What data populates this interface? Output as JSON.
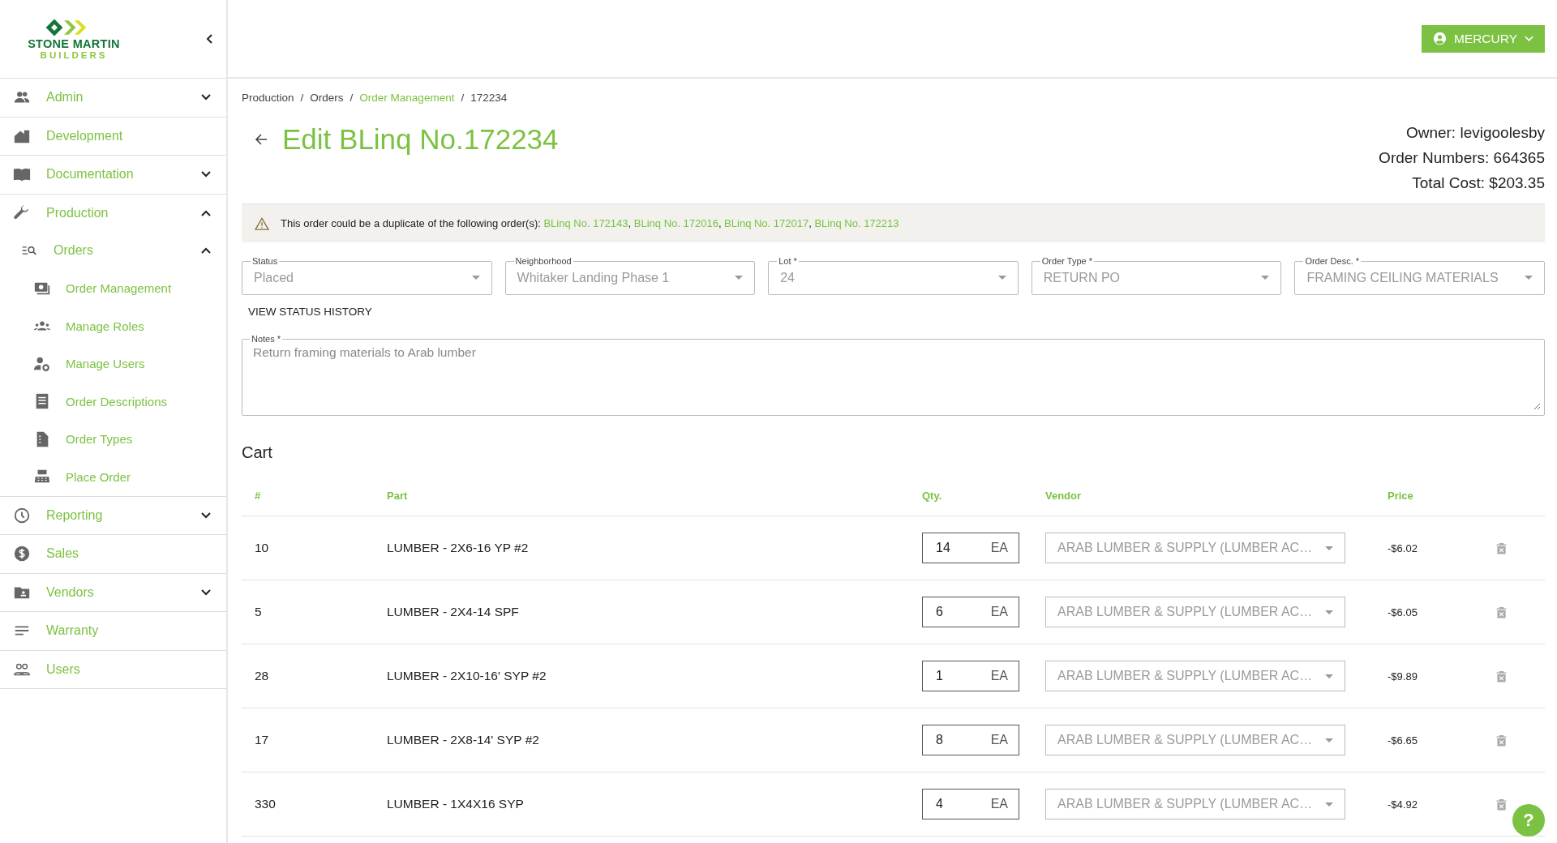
{
  "sidebar": {
    "logo": {
      "name": "STONE MARTIN",
      "tagline": "BUILDERS"
    },
    "items": [
      {
        "label": "Admin",
        "expanded": false
      },
      {
        "label": "Development"
      },
      {
        "label": "Documentation",
        "expanded": false
      },
      {
        "label": "Production",
        "expanded": true,
        "children": [
          {
            "label": "Orders",
            "expanded": true,
            "children": [
              {
                "label": "Order Management"
              },
              {
                "label": "Manage Roles"
              },
              {
                "label": "Manage Users"
              },
              {
                "label": "Order Descriptions"
              },
              {
                "label": "Order Types"
              },
              {
                "label": "Place Order"
              }
            ]
          }
        ]
      },
      {
        "label": "Reporting",
        "expanded": false
      },
      {
        "label": "Sales"
      },
      {
        "label": "Vendors",
        "expanded": false
      },
      {
        "label": "Warranty"
      },
      {
        "label": "Users"
      }
    ]
  },
  "header": {
    "user_button": "MERCURY"
  },
  "breadcrumb": [
    {
      "label": "Production",
      "link": false
    },
    {
      "separator": "/",
      "label": "Orders",
      "link": false
    },
    {
      "separator": "/",
      "label": "Order Management",
      "link": true
    },
    {
      "separator": "/",
      "label": "172234",
      "link": false
    }
  ],
  "page": {
    "title": "Edit BLinq No.172234",
    "owner": "Owner: levigoolesby",
    "order_numbers": "Order Numbers: 664365",
    "total_cost": "Total Cost: $203.35"
  },
  "alert": {
    "message": "This order could be a duplicate of the following order(s):",
    "links": [
      {
        "label": "BLinq No. 172143",
        "separator": ","
      },
      {
        "label": "BLinq No. 172016",
        "separator": ","
      },
      {
        "label": "BLinq No. 172017",
        "separator": ","
      },
      {
        "label": "BLinq No. 172213"
      }
    ]
  },
  "fields": [
    {
      "label": "Status",
      "value": "Placed"
    },
    {
      "label": "Neighborhood",
      "value": "Whitaker Landing Phase 1"
    },
    {
      "label": "Lot *",
      "value": "24"
    },
    {
      "label": "Order Type *",
      "value": "RETURN PO"
    },
    {
      "label": "Order Desc. *",
      "value": "FRAMING CEILING MATERIALS"
    }
  ],
  "status_history_button": "VIEW STATUS HISTORY",
  "notes": {
    "label": "Notes *",
    "value": "Return framing materials to Arab lumber"
  },
  "cart": {
    "title": "Cart",
    "columns": [
      "#",
      "Part",
      "Qty.",
      "Vendor",
      "Price"
    ],
    "rows": [
      {
        "number": "10",
        "part": "LUMBER - 2X6-16 YP #2",
        "qty": "14",
        "unit": "EA",
        "vendor": "ARAB LUMBER & SUPPLY (LUMBER AC…",
        "price": "-$6.02"
      },
      {
        "number": "5",
        "part": "LUMBER - 2X4-14 SPF",
        "qty": "6",
        "unit": "EA",
        "vendor": "ARAB LUMBER & SUPPLY (LUMBER AC…",
        "price": "-$6.05"
      },
      {
        "number": "28",
        "part": "LUMBER - 2X10-16' SYP #2",
        "qty": "1",
        "unit": "EA",
        "vendor": "ARAB LUMBER & SUPPLY (LUMBER AC…",
        "price": "-$9.89"
      },
      {
        "number": "17",
        "part": "LUMBER - 2X8-14' SYP #2",
        "qty": "8",
        "unit": "EA",
        "vendor": "ARAB LUMBER & SUPPLY (LUMBER AC…",
        "price": "-$6.65"
      },
      {
        "number": "330",
        "part": "LUMBER - 1X4X16 SYP",
        "qty": "4",
        "unit": "EA",
        "vendor": "ARAB LUMBER & SUPPLY (LUMBER AC…",
        "price": "-$4.92"
      }
    ]
  },
  "help_button": "?"
}
